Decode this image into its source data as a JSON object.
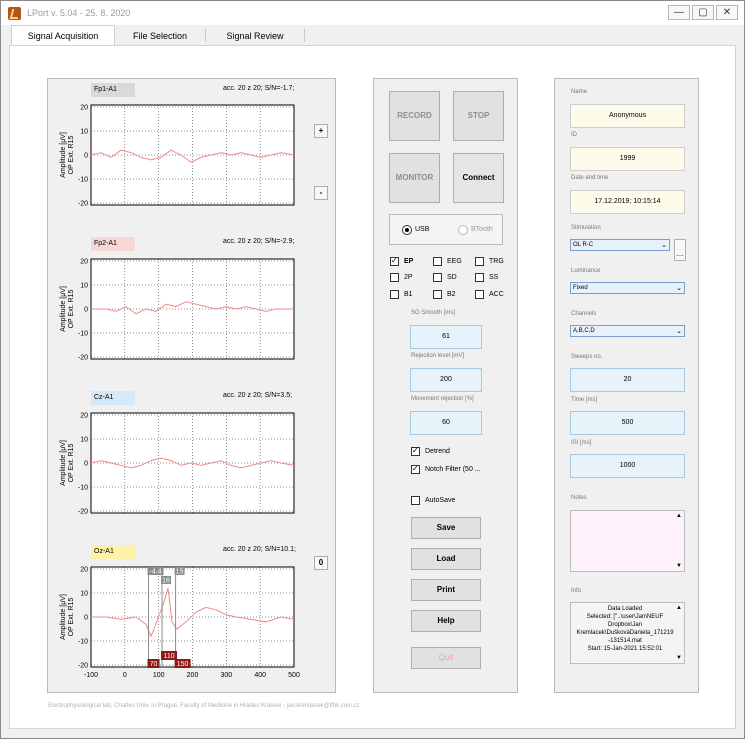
{
  "window": {
    "title": "LPort v. 5.04 - 25. 8. 2020",
    "min_icon": "minimize-icon",
    "max_icon": "maximize-icon",
    "close_icon": "close-icon"
  },
  "tabs": [
    {
      "label": "Signal Acquisition",
      "active": true
    },
    {
      "label": "File Selection",
      "active": false
    },
    {
      "label": "Signal Review",
      "active": false
    }
  ],
  "plots": [
    {
      "channel": "Fp1-A1",
      "info": "acc. 20 z 20; S/N=-1.7;",
      "channel_color": "#d9d9d9"
    },
    {
      "channel": "Fp2-A1",
      "info": "acc. 20 z 20; S/N=-2.9;",
      "channel_color": "#f8d7d7"
    },
    {
      "channel": "Cz-A1",
      "info": "acc. 20 z 20; S/N=3.5;",
      "channel_color": "#d6e9f8"
    },
    {
      "channel": "Oz-A1",
      "info": "acc. 20 z 20; S/N=10.1;",
      "channel_color": "#fff2a8"
    }
  ],
  "plot_axes": {
    "ylabel_line1": "Amplitude [μV]",
    "ylabel_line2": "OP Ext. R15",
    "yticks": [
      "20",
      "10",
      "0",
      "-10",
      "-20"
    ],
    "xticks": [
      "-100",
      "0",
      "100",
      "200",
      "300",
      "400",
      "500"
    ]
  },
  "markers": {
    "top_a": "-4.4",
    "top_b": "16",
    "top_c": "15",
    "bottom_a": "70",
    "bottom_b": "110",
    "bottom_c": "150"
  },
  "side_buttons": {
    "plus": "+",
    "minus": "-",
    "zero": "0"
  },
  "control": {
    "record": "RECORD",
    "stop": "STOP",
    "monitor": "MONITOR",
    "connect": "Connect",
    "usb": "USB",
    "btooth": "BTooth",
    "checkboxes": [
      {
        "label": "EP",
        "checked": true
      },
      {
        "label": "EEG",
        "checked": false
      },
      {
        "label": "TRG",
        "checked": false
      },
      {
        "label": "2P",
        "checked": false
      },
      {
        "label": "SD",
        "checked": false
      },
      {
        "label": "SS",
        "checked": false
      },
      {
        "label": "B1",
        "checked": false
      },
      {
        "label": "B2",
        "checked": false
      },
      {
        "label": "ACC",
        "checked": false
      }
    ],
    "sg_smooth_label": "SG Smooth [ms]",
    "sg_smooth_value": "61",
    "rejection_label": "Rejection level [mV]",
    "rejection_value": "200",
    "movement_label": "Movement rejection [%]",
    "movement_value": "60",
    "detrend": "Detrend",
    "notch": "Notch Filter (50 ...",
    "autosave": "AutoSave",
    "save": "Save",
    "load": "Load",
    "print": "Print",
    "help": "Help",
    "quit": "Quit"
  },
  "info": {
    "name_label": "Name",
    "name_value": "Anonymous",
    "id_label": "ID",
    "id_value": "1999",
    "date_label": "Date and time",
    "date_value": "17.12.2019; 10:15:14",
    "stim_label": "Stimulation",
    "stim_value": "OL R-C",
    "stim_more": "...",
    "lum_label": "Luminance",
    "lum_value": "Fixed",
    "chan_label": "Channels",
    "chan_value": "A,B,C,D",
    "sweeps_label": "Sweeps no.",
    "sweeps_value": "20",
    "time_label": "Time [ms]",
    "time_value": "500",
    "isi_label": "ISI [ms]",
    "isi_value": "1000",
    "notes_label": "Notes",
    "info_label": "Info",
    "info_lines": [
      "Data Loaded",
      "Selected: [\"..\\user\\Jan\\NEUF",
      "Dropbox\\Jan",
      "Kremlacek\\DuškováDaniela_171219",
      "-131514.mat",
      "Start: 15-Jan-2021 15:52:01"
    ]
  },
  "footer": "Electrophysiological lab, Charles Univ. in Prague, Faculty of Medicine in Hradec Kralove - jan.kremlacek@lfhk.cuni.cz",
  "colors": {
    "trace": "#f08a8a",
    "marker_dark": "#8b1a1a",
    "marker_gray": "#8c8c8c"
  }
}
